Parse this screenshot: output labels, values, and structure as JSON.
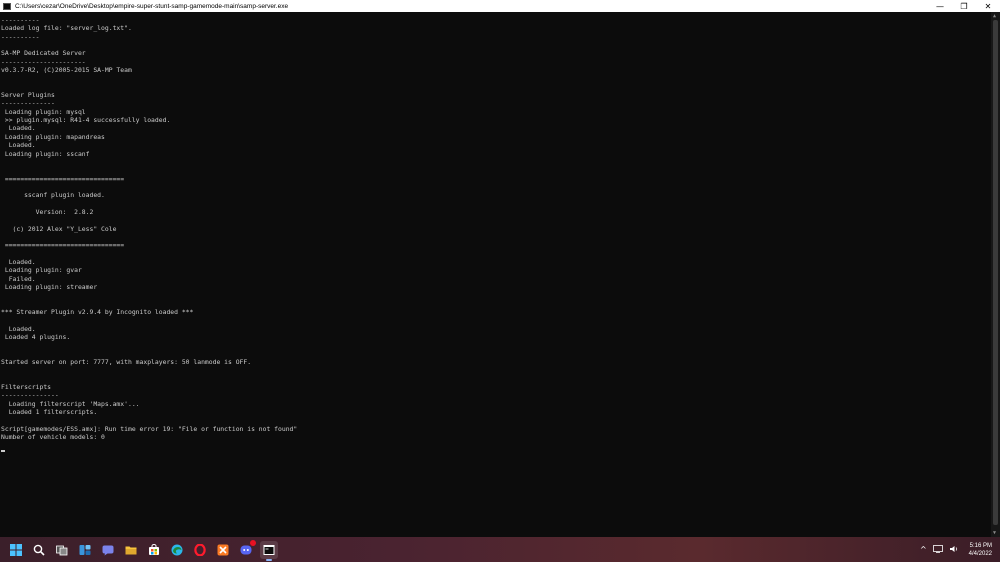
{
  "window": {
    "title": "C:\\Users\\cezar\\OneDrive\\Desktop\\empire-super-stunt-samp-gamemode-main\\samp-server.exe",
    "minimize_glyph": "—",
    "restore_glyph": "❐",
    "close_glyph": "✕"
  },
  "console": {
    "lines": [
      "----------",
      "Loaded log file: \"server_log.txt\".",
      "----------",
      "",
      "SA-MP Dedicated Server",
      "----------------------",
      "v0.3.7-R2, (C)2005-2015 SA-MP Team",
      "",
      "",
      "Server Plugins",
      "--------------",
      " Loading plugin: mysql",
      " >> plugin.mysql: R41-4 successfully loaded.",
      "  Loaded.",
      " Loading plugin: mapandreas",
      "  Loaded.",
      " Loading plugin: sscanf",
      "",
      "",
      " ===============================",
      "",
      "      sscanf plugin loaded.",
      "",
      "         Version:  2.8.2",
      "",
      "   (c) 2012 Alex \"Y_Less\" Cole",
      "",
      " ===============================",
      "",
      "  Loaded.",
      " Loading plugin: gvar",
      "  Failed.",
      " Loading plugin: streamer",
      "",
      "",
      "*** Streamer Plugin v2.9.4 by Incognito loaded ***",
      "",
      "  Loaded.",
      " Loaded 4 plugins.",
      "",
      "",
      "Started server on port: 7777, with maxplayers: 50 lanmode is OFF.",
      "",
      "",
      "Filterscripts",
      "---------------",
      "  Loading filterscript 'Maps.amx'...",
      "  Loaded 1 filterscripts.",
      "",
      "Script[gamemodes/ESS.amx]: Run time error 19: \"File or function is not found\"",
      "Number of vehicle models: 0"
    ]
  },
  "taskbar": {
    "icons": [
      {
        "name": "start-icon",
        "color": "#4cc2ff"
      },
      {
        "name": "search-icon",
        "color": "#ffffff"
      },
      {
        "name": "task-view-icon",
        "color": "#ffffff"
      },
      {
        "name": "widgets-icon",
        "color": "#3a96dd"
      },
      {
        "name": "chat-icon",
        "color": "#7b83eb"
      },
      {
        "name": "file-explorer-icon",
        "color": "#f8c33c"
      },
      {
        "name": "store-icon",
        "color": "#ffffff"
      },
      {
        "name": "edge-icon",
        "color": "#2bb6e8"
      },
      {
        "name": "opera-icon",
        "color": "#ff1b2d"
      },
      {
        "name": "xampp-icon",
        "color": "#fb7a24"
      },
      {
        "name": "discord-icon",
        "color": "#5865f2"
      },
      {
        "name": "console-app-icon",
        "color": "#ffffff"
      }
    ],
    "tray": {
      "chevron": "^",
      "time": "5:16 PM",
      "date": "4/4/2022"
    }
  },
  "colors": {
    "console_bg": "#0c0c0c",
    "console_text": "#cccccc",
    "titlebar_bg": "#ffffff"
  }
}
